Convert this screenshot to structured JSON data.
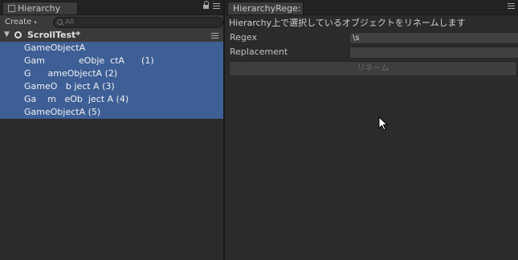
{
  "hierarchy": {
    "tab_label": "Hierarchy",
    "create_label": "Create",
    "create_arrow": "▾",
    "search_placeholder": "All",
    "scene_name": "ScrollTest*",
    "items": [
      "GameObjectA",
      "Gam            eObje  ctA      (1)",
      "G      ameObjectA (2)",
      "GameO   b ject A (3)",
      "Ga    m   eOb  ject A (4)",
      "GameObjectA (5)"
    ]
  },
  "regex_window": {
    "tab_label": "HierarchyRege:",
    "header_text": "Hierarchy上で選択しているオブジェクトをリネームします",
    "regex_label": "Regex",
    "regex_value": "\\s",
    "replacement_label": "Replacement",
    "replacement_value": "",
    "rename_button": "リネーム"
  },
  "colors": {
    "selection": "#3e5f96",
    "panel_bg": "#2b2b2b"
  }
}
